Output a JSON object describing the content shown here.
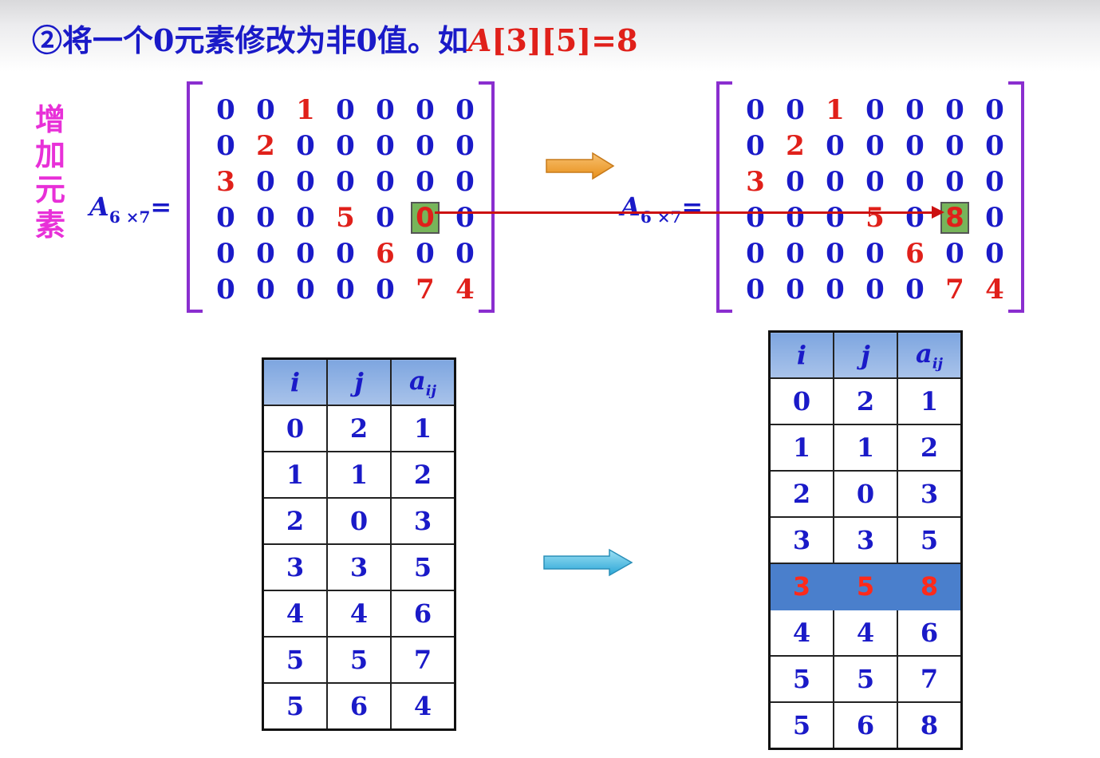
{
  "title": {
    "prefix": "②将一个0元素修改为非0值。如",
    "highlight_a": "A",
    "highlight_rest": "[3][5]=8"
  },
  "side_label": [
    "增",
    "加",
    "元",
    "素"
  ],
  "matrix_label": {
    "letter": "A",
    "sub": "6 ×7",
    "eq": "="
  },
  "matrix_left": [
    [
      0,
      0,
      1,
      0,
      0,
      0,
      0
    ],
    [
      0,
      2,
      0,
      0,
      0,
      0,
      0
    ],
    [
      3,
      0,
      0,
      0,
      0,
      0,
      0
    ],
    [
      0,
      0,
      0,
      5,
      0,
      0,
      0
    ],
    [
      0,
      0,
      0,
      0,
      6,
      0,
      0
    ],
    [
      0,
      0,
      0,
      0,
      0,
      7,
      4
    ]
  ],
  "matrix_right": [
    [
      0,
      0,
      1,
      0,
      0,
      0,
      0
    ],
    [
      0,
      2,
      0,
      0,
      0,
      0,
      0
    ],
    [
      3,
      0,
      0,
      0,
      0,
      0,
      0
    ],
    [
      0,
      0,
      0,
      5,
      0,
      8,
      0
    ],
    [
      0,
      0,
      0,
      0,
      6,
      0,
      0
    ],
    [
      0,
      0,
      0,
      0,
      0,
      7,
      4
    ]
  ],
  "table_headers": {
    "i": "i",
    "j": "j",
    "a": "a",
    "a_sub": "ij"
  },
  "table_left": [
    [
      "0",
      "2",
      "1"
    ],
    [
      "1",
      "1",
      "2"
    ],
    [
      "2",
      "0",
      "3"
    ],
    [
      "3",
      "3",
      "5"
    ],
    [
      "4",
      "4",
      "6"
    ],
    [
      "5",
      "5",
      "7"
    ],
    [
      "5",
      "6",
      "4"
    ]
  ],
  "table_right": [
    [
      "0",
      "2",
      "1"
    ],
    [
      "1",
      "1",
      "2"
    ],
    [
      "2",
      "0",
      "3"
    ],
    [
      "3",
      "3",
      "5"
    ],
    [
      "3",
      "5",
      "8"
    ],
    [
      "4",
      "4",
      "6"
    ],
    [
      "5",
      "5",
      "7"
    ],
    [
      "5",
      "6",
      "8"
    ]
  ],
  "table_right_highlight_row": 4,
  "colors": {
    "blue_text": "#1a1ac8",
    "red_text": "#e0201a",
    "bracket": "#8a2ecf",
    "side_label": "#e830d8",
    "highlight_row": "#4a7fcc",
    "cell_highlight": "#77b55a",
    "orange_arrow": "#f0a030",
    "cyan_arrow": "#40b8e0"
  }
}
